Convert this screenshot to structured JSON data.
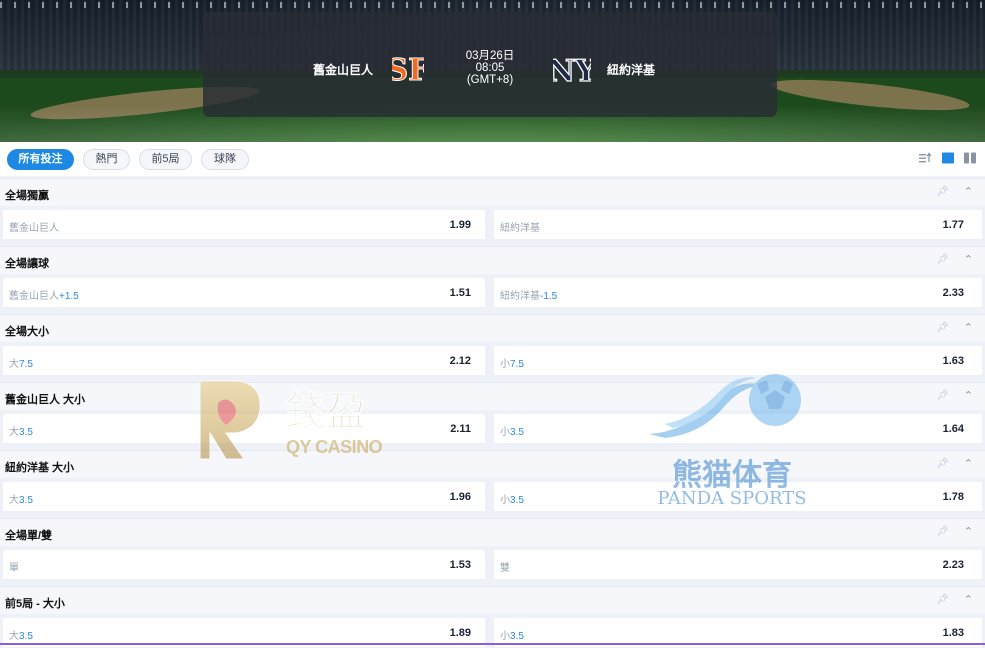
{
  "match": {
    "home_team": "舊金山巨人",
    "away_team": "紐約洋基",
    "date": "03月26日",
    "time": "08:05",
    "timezone": "(GMT+8)",
    "home_logo_icon": "sf-giants-logo-icon",
    "away_logo_icon": "ny-yankees-logo-icon"
  },
  "tabs": [
    {
      "label": "所有投注",
      "active": true
    },
    {
      "label": "熱門",
      "active": false
    },
    {
      "label": "前5局",
      "active": false
    },
    {
      "label": "球隊",
      "active": false
    }
  ],
  "toolbar": {
    "icons": [
      "sort-icon",
      "single-column-icon",
      "two-column-icon"
    ]
  },
  "markets": [
    {
      "title": "全場獨贏",
      "left": {
        "label": "舊金山巨人",
        "highlight": "",
        "odds": "1.99"
      },
      "right": {
        "label": "紐約洋基",
        "highlight": "",
        "odds": "1.77"
      }
    },
    {
      "title": "全場讓球",
      "left": {
        "label": "舊金山巨人",
        "highlight": "+1.5",
        "odds": "1.51"
      },
      "right": {
        "label": "紐約洋基",
        "highlight": "-1.5",
        "odds": "2.33"
      }
    },
    {
      "title": "全場大小",
      "left": {
        "label": "大",
        "highlight": "7.5",
        "odds": "2.12"
      },
      "right": {
        "label": "小",
        "highlight": "7.5",
        "odds": "1.63"
      }
    },
    {
      "title": "舊金山巨人 大小",
      "left": {
        "label": "大",
        "highlight": "3.5",
        "odds": "2.11"
      },
      "right": {
        "label": "小",
        "highlight": "3.5",
        "odds": "1.64"
      }
    },
    {
      "title": "紐約洋基 大小",
      "left": {
        "label": "大",
        "highlight": "3.5",
        "odds": "1.96"
      },
      "right": {
        "label": "小",
        "highlight": "3.5",
        "odds": "1.78"
      }
    },
    {
      "title": "全場單/雙",
      "left": {
        "label": "單",
        "highlight": "",
        "odds": "1.53"
      },
      "right": {
        "label": "雙",
        "highlight": "",
        "odds": "2.23"
      }
    },
    {
      "title": "前5局 - 大小",
      "left": {
        "label": "大",
        "highlight": "3.5",
        "odds": "1.89"
      },
      "right": {
        "label": "小",
        "highlight": "3.5",
        "odds": "1.83"
      }
    }
  ],
  "watermarks": {
    "qy": {
      "title": "錢盈",
      "subtitle": "QY CASINO"
    },
    "panda": {
      "title": "熊猫体育",
      "subtitle": "PANDA SPORTS"
    }
  },
  "colors": {
    "accent": "#1e88e5",
    "odds_highlight": "#2b8ae0",
    "giants_orange": "#f26a21"
  }
}
